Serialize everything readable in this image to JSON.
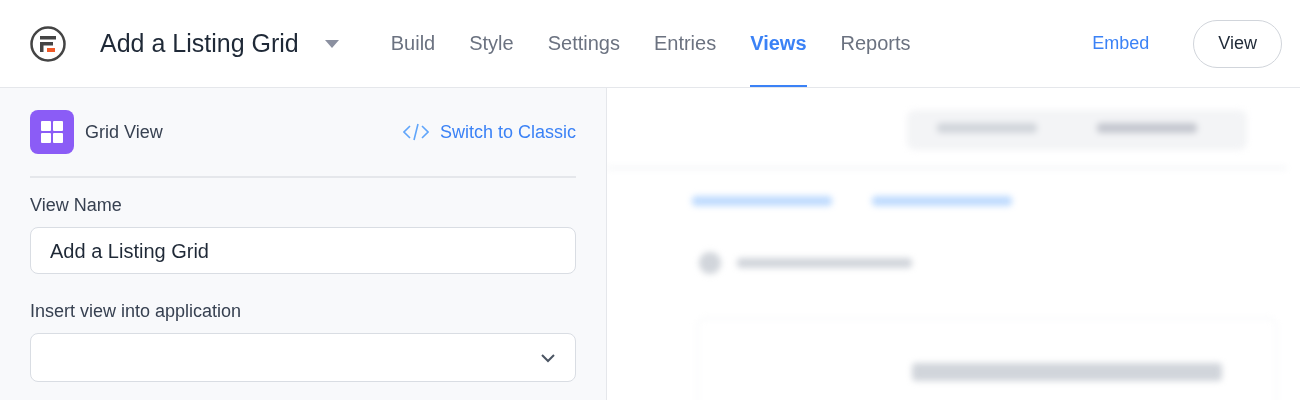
{
  "header": {
    "title": "Add a Listing Grid",
    "tabs": [
      {
        "label": "Build",
        "selected": false
      },
      {
        "label": "Style",
        "selected": false
      },
      {
        "label": "Settings",
        "selected": false
      },
      {
        "label": "Entries",
        "selected": false
      },
      {
        "label": "Views",
        "selected": true
      },
      {
        "label": "Reports",
        "selected": false
      }
    ],
    "embed": "Embed",
    "view_button": "View"
  },
  "sidebar": {
    "view_type": "Grid View",
    "switch_link": "Switch to Classic",
    "fields": [
      {
        "kind": "text",
        "label": "View Name",
        "value": "Add a Listing Grid"
      },
      {
        "kind": "select",
        "label": "Insert view into application"
      }
    ]
  }
}
